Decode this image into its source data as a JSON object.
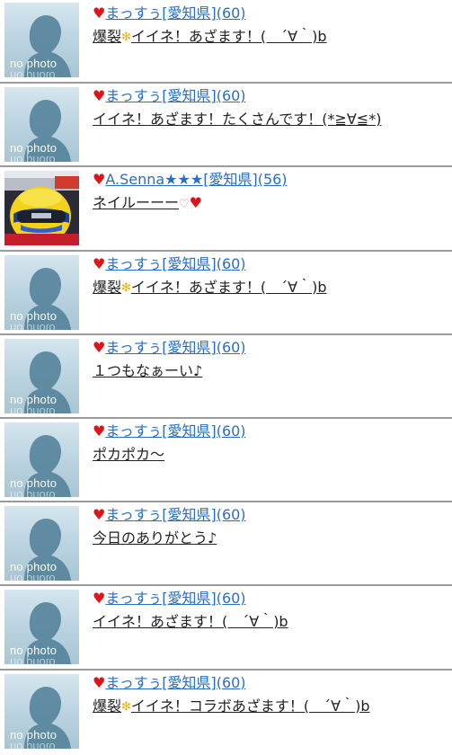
{
  "heart_glyph": "♥",
  "avatar_text": "no photo",
  "emoji": {
    "sparkle": "❇",
    "pink_heart": "♡",
    "red_heart": "♥"
  },
  "posts": [
    {
      "name": "まっすぅ[愛知県](60)",
      "msg_before": "爆裂",
      "emoji": "sparkle",
      "msg_after": "イイネ！あざます！(　´∀｀)b",
      "avatar": "no_photo"
    },
    {
      "name": "まっすぅ[愛知県](60)",
      "msg_before": "イイネ！あざます！たくさんです！(*≧∀≦*)",
      "emoji": "",
      "msg_after": "",
      "avatar": "no_photo"
    },
    {
      "name": "A.Senna★★★[愛知県](56)",
      "msg_before": "ネイルーーー",
      "emoji": "pink_heart_red_heart",
      "msg_after": "",
      "avatar": "racing_helmet_photo"
    },
    {
      "name": "まっすぅ[愛知県](60)",
      "msg_before": "爆裂",
      "emoji": "sparkle",
      "msg_after": "イイネ！あざます！(　´∀｀)b",
      "avatar": "no_photo"
    },
    {
      "name": "まっすぅ[愛知県](60)",
      "msg_before": "１つもなぁーい♪",
      "emoji": "",
      "msg_after": "",
      "avatar": "no_photo"
    },
    {
      "name": "まっすぅ[愛知県](60)",
      "msg_before": "ポカポカ〜",
      "emoji": "",
      "msg_after": "",
      "avatar": "no_photo"
    },
    {
      "name": "まっすぅ[愛知県](60)",
      "msg_before": "今日のありがとう♪",
      "emoji": "",
      "msg_after": "",
      "avatar": "no_photo"
    },
    {
      "name": "まっすぅ[愛知県](60)",
      "msg_before": "イイネ！あざます！(　´∀｀)b",
      "emoji": "",
      "msg_after": "",
      "avatar": "no_photo"
    },
    {
      "name": "まっすぅ[愛知県](60)",
      "msg_before": "爆裂",
      "emoji": "sparkle",
      "msg_after": "イイネ！コラボあざます！(　´∀｀)b",
      "avatar": "no_photo"
    }
  ],
  "colors": {
    "name_link": "#2a6ec0",
    "heart": "#e0151b",
    "separator": "#9a9a9a"
  }
}
